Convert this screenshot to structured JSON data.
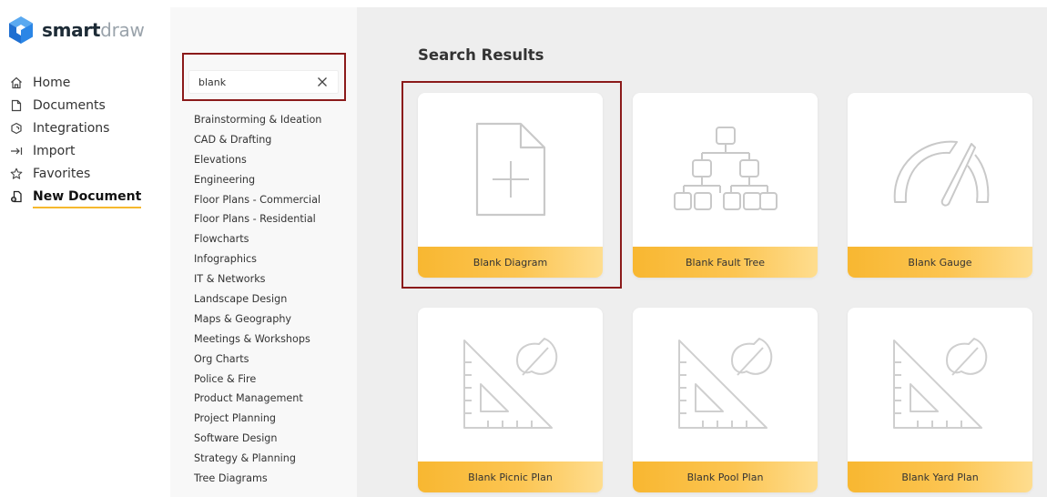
{
  "app": {
    "logo_primary": "smart",
    "logo_secondary": "draw"
  },
  "nav": {
    "items": [
      {
        "label": "Home",
        "icon": "home-icon",
        "active": false
      },
      {
        "label": "Documents",
        "icon": "document-icon",
        "active": false
      },
      {
        "label": "Integrations",
        "icon": "integrations-icon",
        "active": false
      },
      {
        "label": "Import",
        "icon": "import-icon",
        "active": false
      },
      {
        "label": "Favorites",
        "icon": "star-icon",
        "active": false
      },
      {
        "label": "New Document",
        "icon": "new-document-icon",
        "active": true
      }
    ]
  },
  "search": {
    "value": "blank",
    "placeholder": ""
  },
  "categories": [
    "Brainstorming & Ideation",
    "CAD & Drafting",
    "Elevations",
    "Engineering",
    "Floor Plans - Commercial",
    "Floor Plans - Residential",
    "Flowcharts",
    "Infographics",
    "IT & Networks",
    "Landscape Design",
    "Maps & Geography",
    "Meetings & Workshops",
    "Org Charts",
    "Police & Fire",
    "Product Management",
    "Project Planning",
    "Software Design",
    "Strategy & Planning",
    "Tree Diagrams"
  ],
  "results": {
    "heading": "Search Results",
    "cards": [
      {
        "label": "Blank Diagram",
        "icon": "blank-document-icon"
      },
      {
        "label": "Blank Fault Tree",
        "icon": "fault-tree-icon"
      },
      {
        "label": "Blank Gauge",
        "icon": "gauge-icon"
      },
      {
        "label": "Blank Picnic Plan",
        "icon": "landscape-plan-icon"
      },
      {
        "label": "Blank Pool Plan",
        "icon": "landscape-plan-icon"
      },
      {
        "label": "Blank Yard Plan",
        "icon": "landscape-plan-icon"
      }
    ]
  },
  "colors": {
    "accent": "#f5b82e",
    "highlight": "#8b1a1a",
    "logo_blue": "#2b7de1"
  }
}
